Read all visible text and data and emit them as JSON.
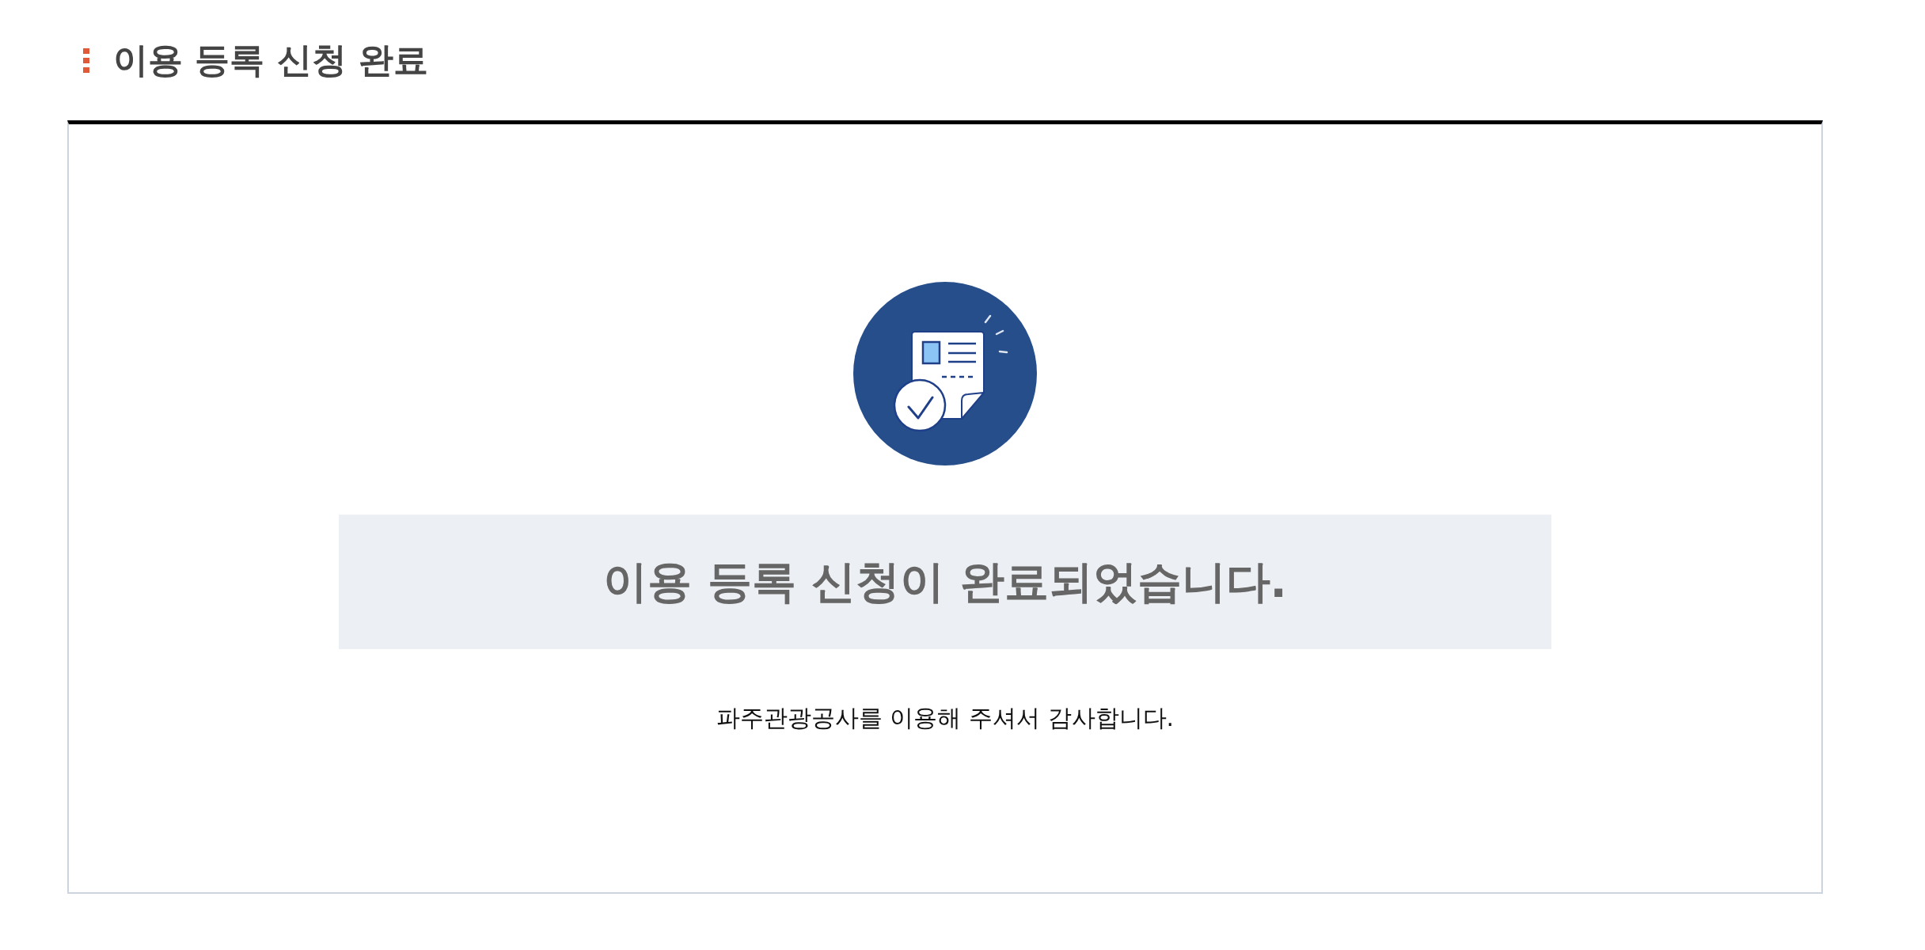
{
  "page_title": "이용 등록 신청 완료",
  "completion": {
    "heading": "이용 등록 신청이 완료되었습니다.",
    "message": "파주관광공사를 이용해 주셔서 감사합니다."
  }
}
